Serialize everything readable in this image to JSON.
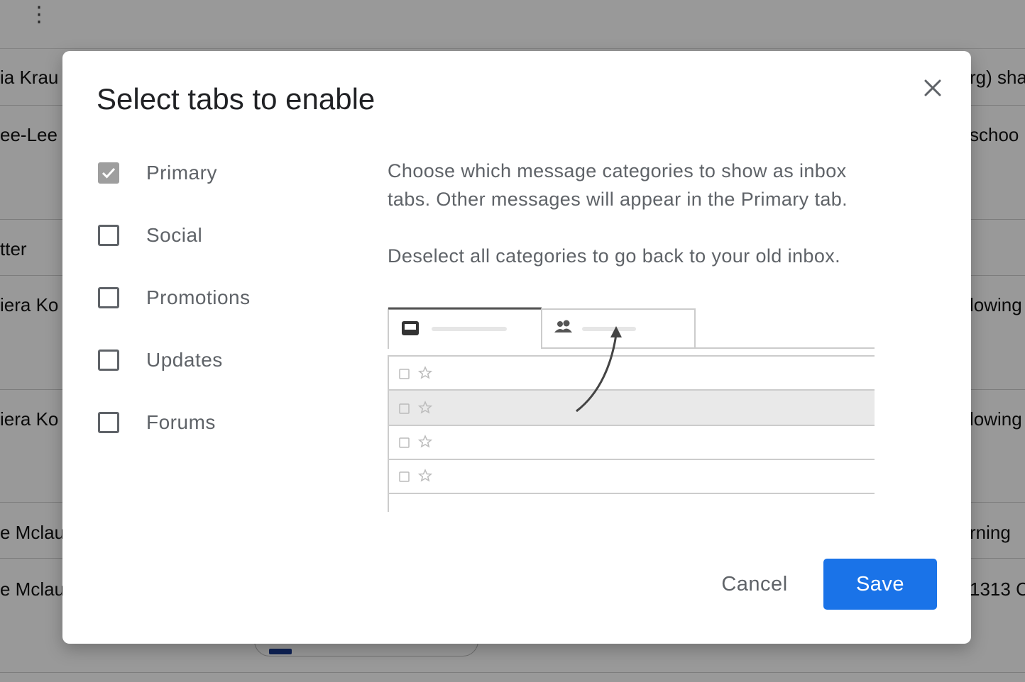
{
  "background": {
    "menu_glyph": "⋮",
    "rows": [
      {
        "left": "ia Krau",
        "right": "rg) sha"
      },
      {
        "left": "ee-Lee",
        "right": "schoo"
      },
      {
        "left": "tter",
        "right": ""
      },
      {
        "left": "iera Ko",
        "right": "lowing"
      },
      {
        "left": "iera Ko",
        "right": "lowing"
      },
      {
        "left": "e Mclau",
        "right": "rning"
      },
      {
        "left": "e Mclau",
        "right": "1313 C"
      }
    ]
  },
  "dialog": {
    "title": "Select tabs to enable",
    "close_icon": "close-icon",
    "categories": [
      {
        "label": "Primary",
        "checked": true
      },
      {
        "label": "Social",
        "checked": false
      },
      {
        "label": "Promotions",
        "checked": false
      },
      {
        "label": "Updates",
        "checked": false
      },
      {
        "label": "Forums",
        "checked": false
      }
    ],
    "description_line1": "Choose which message categories to show as inbox",
    "description_line2": "tabs. Other messages will appear in the Primary tab.",
    "description_line3": "Deselect all categories to go back to your old inbox.",
    "illustration": {
      "tab1_icon": "inbox-icon",
      "tab2_icon": "people-icon",
      "row_icons": [
        "checkbox-icon",
        "star-icon"
      ],
      "row_count": 4
    },
    "cancel_label": "Cancel",
    "save_label": "Save",
    "colors": {
      "accent": "#1a73e8",
      "checked_box": "#9e9e9e",
      "text": "#5f6368"
    }
  }
}
